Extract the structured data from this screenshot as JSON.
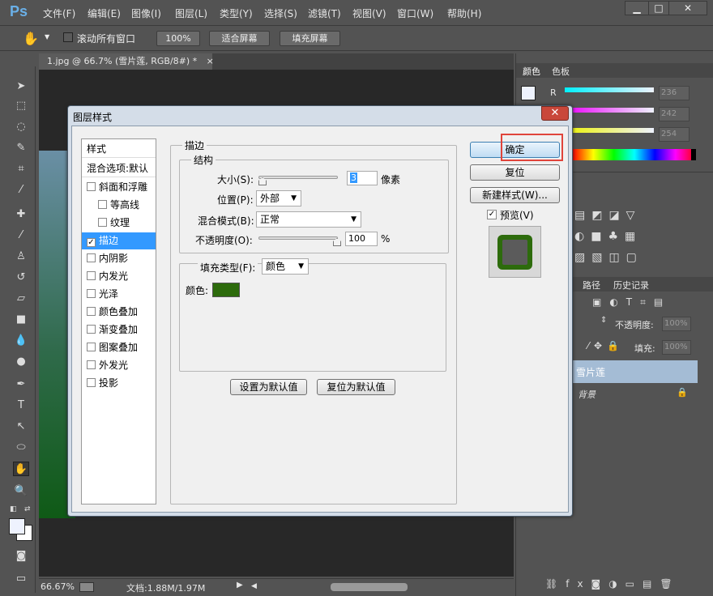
{
  "app": {
    "logo": "Ps"
  },
  "menu": [
    "文件(F)",
    "编辑(E)",
    "图像(I)",
    "图层(L)",
    "类型(Y)",
    "选择(S)",
    "滤镜(T)",
    "视图(V)",
    "窗口(W)",
    "帮助(H)"
  ],
  "window_controls": {
    "minimize": "▁",
    "maximize": "□",
    "close": "✕"
  },
  "options": {
    "scroll_all": "滚动所有窗口",
    "zoom_100": "100%",
    "fit_screen": "适合屏幕",
    "fill_screen": "填充屏幕"
  },
  "document": {
    "tab": "1.jpg @ 66.7% (雪片莲, RGB/8#) *",
    "close": "×"
  },
  "status": {
    "zoom": "66.67%",
    "doc": "文档:1.88M/1.97M"
  },
  "right_panel": {
    "tabs": [
      "颜色",
      "色板"
    ],
    "r_label": "R",
    "values": [
      "236",
      "242",
      "254"
    ],
    "tabs2": [
      "路径",
      "历史记录"
    ],
    "opacity_label": "不透明度:",
    "opacity_value": "100%",
    "fill_label": "填充:",
    "fill_value": "100%",
    "layers": [
      {
        "name": "雪片莲"
      },
      {
        "name": "背景"
      }
    ]
  },
  "dialog": {
    "title": "图层样式",
    "close": "✕",
    "styles_header": "样式",
    "blend_default": "混合选项:默认",
    "items": [
      {
        "label": "斜面和浮雕",
        "checked": false,
        "indent": false
      },
      {
        "label": "等高线",
        "checked": false,
        "indent": true
      },
      {
        "label": "纹理",
        "checked": false,
        "indent": true
      },
      {
        "label": "描边",
        "checked": true,
        "indent": false,
        "selected": true
      },
      {
        "label": "内阴影",
        "checked": false,
        "indent": false
      },
      {
        "label": "内发光",
        "checked": false,
        "indent": false
      },
      {
        "label": "光泽",
        "checked": false,
        "indent": false
      },
      {
        "label": "颜色叠加",
        "checked": false,
        "indent": false
      },
      {
        "label": "渐变叠加",
        "checked": false,
        "indent": false
      },
      {
        "label": "图案叠加",
        "checked": false,
        "indent": false
      },
      {
        "label": "外发光",
        "checked": false,
        "indent": false
      },
      {
        "label": "投影",
        "checked": false,
        "indent": false
      }
    ],
    "section_title": "描边",
    "structure_title": "结构",
    "size_label": "大小(S):",
    "size_value": "3",
    "size_unit": "像素",
    "position_label": "位置(P):",
    "position_value": "外部",
    "blend_label": "混合模式(B):",
    "blend_value": "正常",
    "opacity_label": "不透明度(O):",
    "opacity_value": "100",
    "opacity_unit": "%",
    "fill_type_label": "填充类型(F):",
    "fill_type_value": "颜色",
    "color_label": "颜色:",
    "stroke_color": "#2d6b0c",
    "set_default": "设置为默认值",
    "reset_default": "复位为默认值",
    "ok": "确定",
    "reset": "复位",
    "new_style": "新建样式(W)...",
    "preview_label": "预览(V)",
    "preview_checked": "✓"
  }
}
